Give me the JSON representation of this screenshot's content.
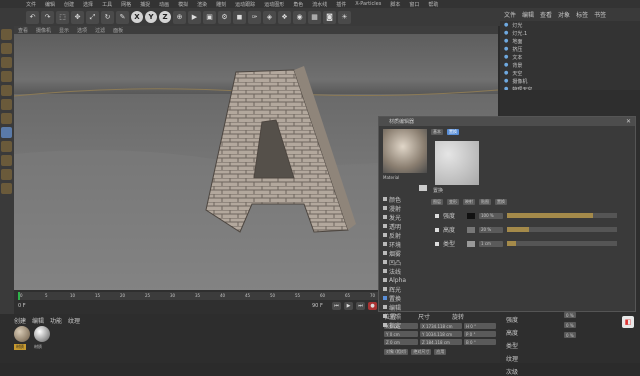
{
  "app": {
    "brand": "Cinema 4D"
  },
  "menubar": {
    "items": [
      "文件",
      "编辑",
      "创建",
      "选择",
      "工具",
      "网格",
      "捕捉",
      "动画",
      "模拟",
      "渲染",
      "雕刻",
      "运动跟踪",
      "运动图形",
      "角色",
      "流水线",
      "插件",
      "X-Particles",
      "脚本",
      "窗口",
      "帮助"
    ]
  },
  "toolbar": {
    "axes": [
      "X",
      "Y",
      "Z"
    ]
  },
  "viewport_menu": [
    "查看",
    "摄像机",
    "显示",
    "选项",
    "过滤",
    "面板"
  ],
  "timeline": {
    "ticks": [
      "0",
      "5",
      "10",
      "15",
      "20",
      "25",
      "30",
      "35",
      "40",
      "45",
      "50",
      "55",
      "60",
      "65",
      "70",
      "75",
      "80",
      "85",
      "90"
    ],
    "current_frame": "0 F",
    "end_frame": "90 F"
  },
  "materials": {
    "menu": [
      "创建",
      "编辑",
      "功能",
      "纹理"
    ],
    "items": [
      "材质",
      "材质"
    ]
  },
  "object_manager": {
    "menu": [
      "文件",
      "编辑",
      "查看",
      "对象",
      "标签",
      "书签"
    ],
    "objects": [
      "灯光",
      "灯光.1",
      "地面",
      "挤压",
      "文本",
      "背景",
      "天空",
      "摄像机",
      "物理天空"
    ]
  },
  "material_editor": {
    "title": "材质编辑器",
    "tabs": [
      "基本",
      "置换"
    ],
    "preview_label": "Material",
    "channels": [
      "颜色",
      "漫射",
      "发光",
      "透明",
      "反射",
      "环境",
      "烟雾",
      "凹凸",
      "法线",
      "Alpha",
      "辉光",
      "置换",
      "编辑",
      "光照",
      "指定"
    ],
    "section_title": "置换",
    "row_labels": [
      "强度",
      "高度",
      "类型"
    ],
    "values": [
      "100 %",
      "20 %",
      "1 cm"
    ],
    "mode_options": [
      "图层",
      "变形",
      "映射",
      "贴图",
      "置换"
    ],
    "value_fill": 0.78
  },
  "coordinates": {
    "headers": [
      "位置",
      "尺寸",
      "旋转"
    ],
    "rows": [
      [
        "X 0 cm",
        "X 1734.118 cm",
        "H 0 °"
      ],
      [
        "Y 0 cm",
        "Y 1034.118 cm",
        "P 0 °"
      ],
      [
        "Z 0 cm",
        "Z 184.118 cm",
        "B 0 °"
      ]
    ],
    "buttons": [
      "对象 (相对)",
      "绝对尺寸",
      "应用"
    ]
  },
  "attributes": {
    "rows": [
      "置换",
      "强度",
      "高度",
      "类型",
      "纹理",
      "次级"
    ],
    "values": [
      "0 %",
      "0 %",
      "0 %"
    ]
  },
  "colors": {
    "accent": "#a48a4a",
    "highlight": "#5a8fd8",
    "brick": "#b8aca0"
  }
}
